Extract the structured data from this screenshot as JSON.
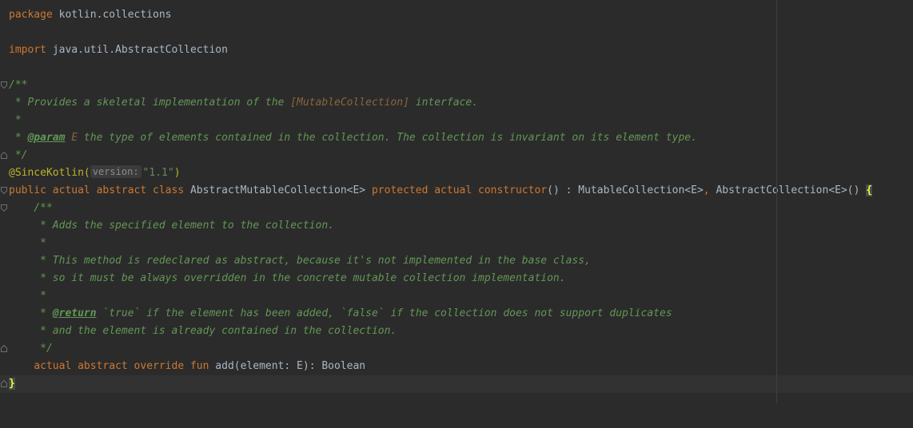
{
  "editor": {
    "language": "Kotlin",
    "colors": {
      "background": "#2b2b2b",
      "text": "#a9b7c6",
      "keyword": "#cc7832",
      "annotation": "#bbb529",
      "string": "#6a8759",
      "doc_comment": "#629755",
      "doc_reference": "#8a653b",
      "brace_match": "#ffef28"
    },
    "lines": {
      "package_kw": "package",
      "package_name": " kotlin.collections",
      "import_kw": "import",
      "import_name": " java.util.AbstractCollection",
      "doc1_open": "/**",
      "doc1_l1_a": " * Provides a skeletal implementation of the ",
      "doc1_l1_link": "[MutableCollection]",
      "doc1_l1_b": " interface.",
      "doc1_l2": " *",
      "doc1_l3_a": " * ",
      "doc1_l3_tag": "@param",
      "doc1_l3_param": " E",
      "doc1_l3_b": " the type of elements contained in the collection. The collection is invariant on its element type.",
      "doc1_close": " */",
      "annotation": "@SinceKotlin(",
      "annotation_hint": "version:",
      "annotation_value": "\"1.1\"",
      "annotation_close": ")",
      "class_kw1": "public actual abstract class",
      "class_name": " AbstractMutableCollection<E> ",
      "class_kw2": "protected actual constructor",
      "class_rest_a": "() : MutableCollection<E>",
      "class_comma": ",",
      "class_rest_b": " AbstractCollection<E>() ",
      "class_brace": "{",
      "doc2_open": "    /**",
      "doc2_l1": "     * Adds the specified element to the collection.",
      "doc2_l2": "     *",
      "doc2_l3": "     * This method is redeclared as abstract, because it's not implemented in the base class,",
      "doc2_l4": "     * so it must be always overridden in the concrete mutable collection implementation.",
      "doc2_l5": "     *",
      "doc2_l6_a": "     * ",
      "doc2_l6_tag": "@return",
      "doc2_l6_b": " `true` if the element has been added, `false` if the collection does not support duplicates",
      "doc2_l7": "     * and the element is already contained in the collection.",
      "doc2_close": "     */",
      "fun_indent": "    ",
      "fun_kw": "actual abstract override fun",
      "fun_sig": " add(element: E): Boolean",
      "close_brace": "}"
    }
  }
}
